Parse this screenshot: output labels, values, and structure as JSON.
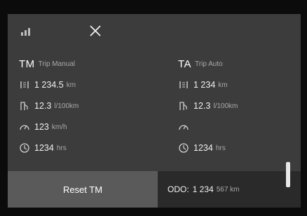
{
  "trip_tm": {
    "abbr": "TM",
    "subtitle": "Trip Manual",
    "distance": {
      "value": "1 234.5",
      "unit": "km"
    },
    "consumption": {
      "value": "12.3",
      "unit": "l/100km"
    },
    "avg_speed": {
      "value": "123",
      "unit": "km/h"
    },
    "time": {
      "value": "1234",
      "unit": "hrs"
    }
  },
  "trip_ta": {
    "abbr": "TA",
    "subtitle": "Trip Auto",
    "distance": {
      "value": "1 234",
      "unit": "km"
    },
    "consumption": {
      "value": "12.3",
      "unit": "l/100km"
    },
    "avg_speed": {
      "value": "",
      "unit": ""
    },
    "time": {
      "value": "1234",
      "unit": "hrs"
    }
  },
  "actions": {
    "reset_label": "Reset TM"
  },
  "odometer": {
    "label": "ODO:",
    "value": "1 234",
    "unit": "567 km"
  },
  "icons": {
    "signal": "signal-strength-icon",
    "close": "close-icon",
    "distance": "distance-icon",
    "consumption": "fuel-consumption-icon",
    "speed": "speedometer-icon",
    "time": "clock-icon"
  },
  "colors": {
    "panel": "#3c3c3c",
    "reset_button": "#5a5a5a",
    "background": "#0b0b0b"
  }
}
